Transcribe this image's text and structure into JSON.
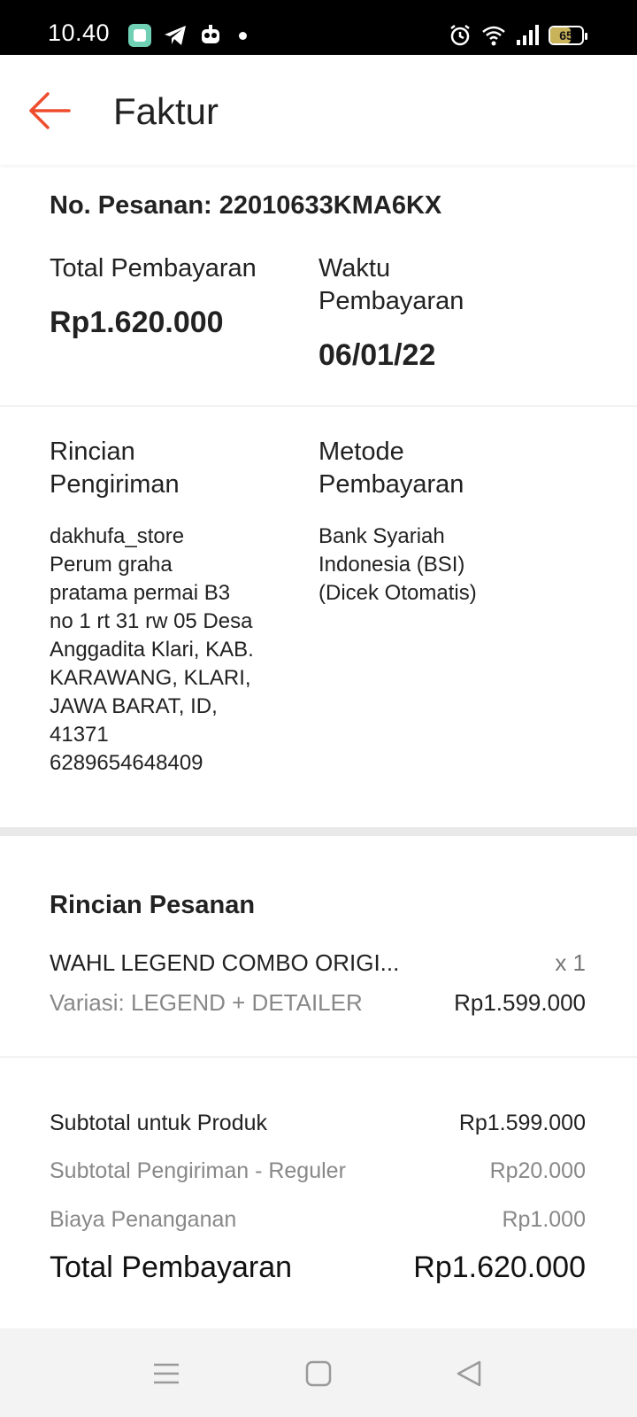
{
  "status_bar": {
    "time": "10.40",
    "battery_level": "65",
    "battery_fraction": 0.65,
    "left_icons": [
      "app-notification-icon",
      "telegram-icon",
      "robot-icon"
    ],
    "right_icons": [
      "alarm-icon",
      "wifi-icon",
      "signal-icon",
      "battery-icon"
    ]
  },
  "header": {
    "title": "Faktur",
    "back_icon": "back-arrow-icon",
    "accent_color": "#ee4d2d"
  },
  "order": {
    "number_line": "No. Pesanan: 22010633KMA6KX",
    "total_payment_label": "Total Pembayaran",
    "total_payment_value": "Rp1.620.000",
    "payment_time_label": "Waktu\nPembayaran",
    "payment_time_value": "06/01/22"
  },
  "shipping": {
    "label": "Rincian\nPengiriman",
    "details": "dakhufa_store\nPerum graha\npratama permai B3\nno 1 rt 31 rw 05 Desa\nAnggadita Klari, KAB.\nKARAWANG, KLARI,\nJAWA BARAT, ID,\n41371\n6289654648409"
  },
  "payment_method": {
    "label": "Metode\nPembayaran",
    "details": "Bank Syariah\nIndonesia (BSI)\n(Dicek Otomatis)"
  },
  "order_details": {
    "title": "Rincian Pesanan",
    "item_name": "WAHL LEGEND COMBO ORIGI...",
    "item_qty": "x 1",
    "item_variant": "Variasi: LEGEND + DETAILER",
    "item_price": "Rp1.599.000"
  },
  "summary": {
    "subtotal_product_label": "Subtotal untuk Produk",
    "subtotal_product_value": "Rp1.599.000",
    "subtotal_shipping_label": "Subtotal Pengiriman - Reguler",
    "subtotal_shipping_value": "Rp20.000",
    "handling_fee_label": "Biaya Penanganan",
    "handling_fee_value": "Rp1.000",
    "total_label": "Total Pembayaran",
    "total_value": "Rp1.620.000"
  },
  "nav_bar": {
    "buttons": [
      "menu-icon",
      "home-square-icon",
      "back-triangle-icon"
    ]
  }
}
